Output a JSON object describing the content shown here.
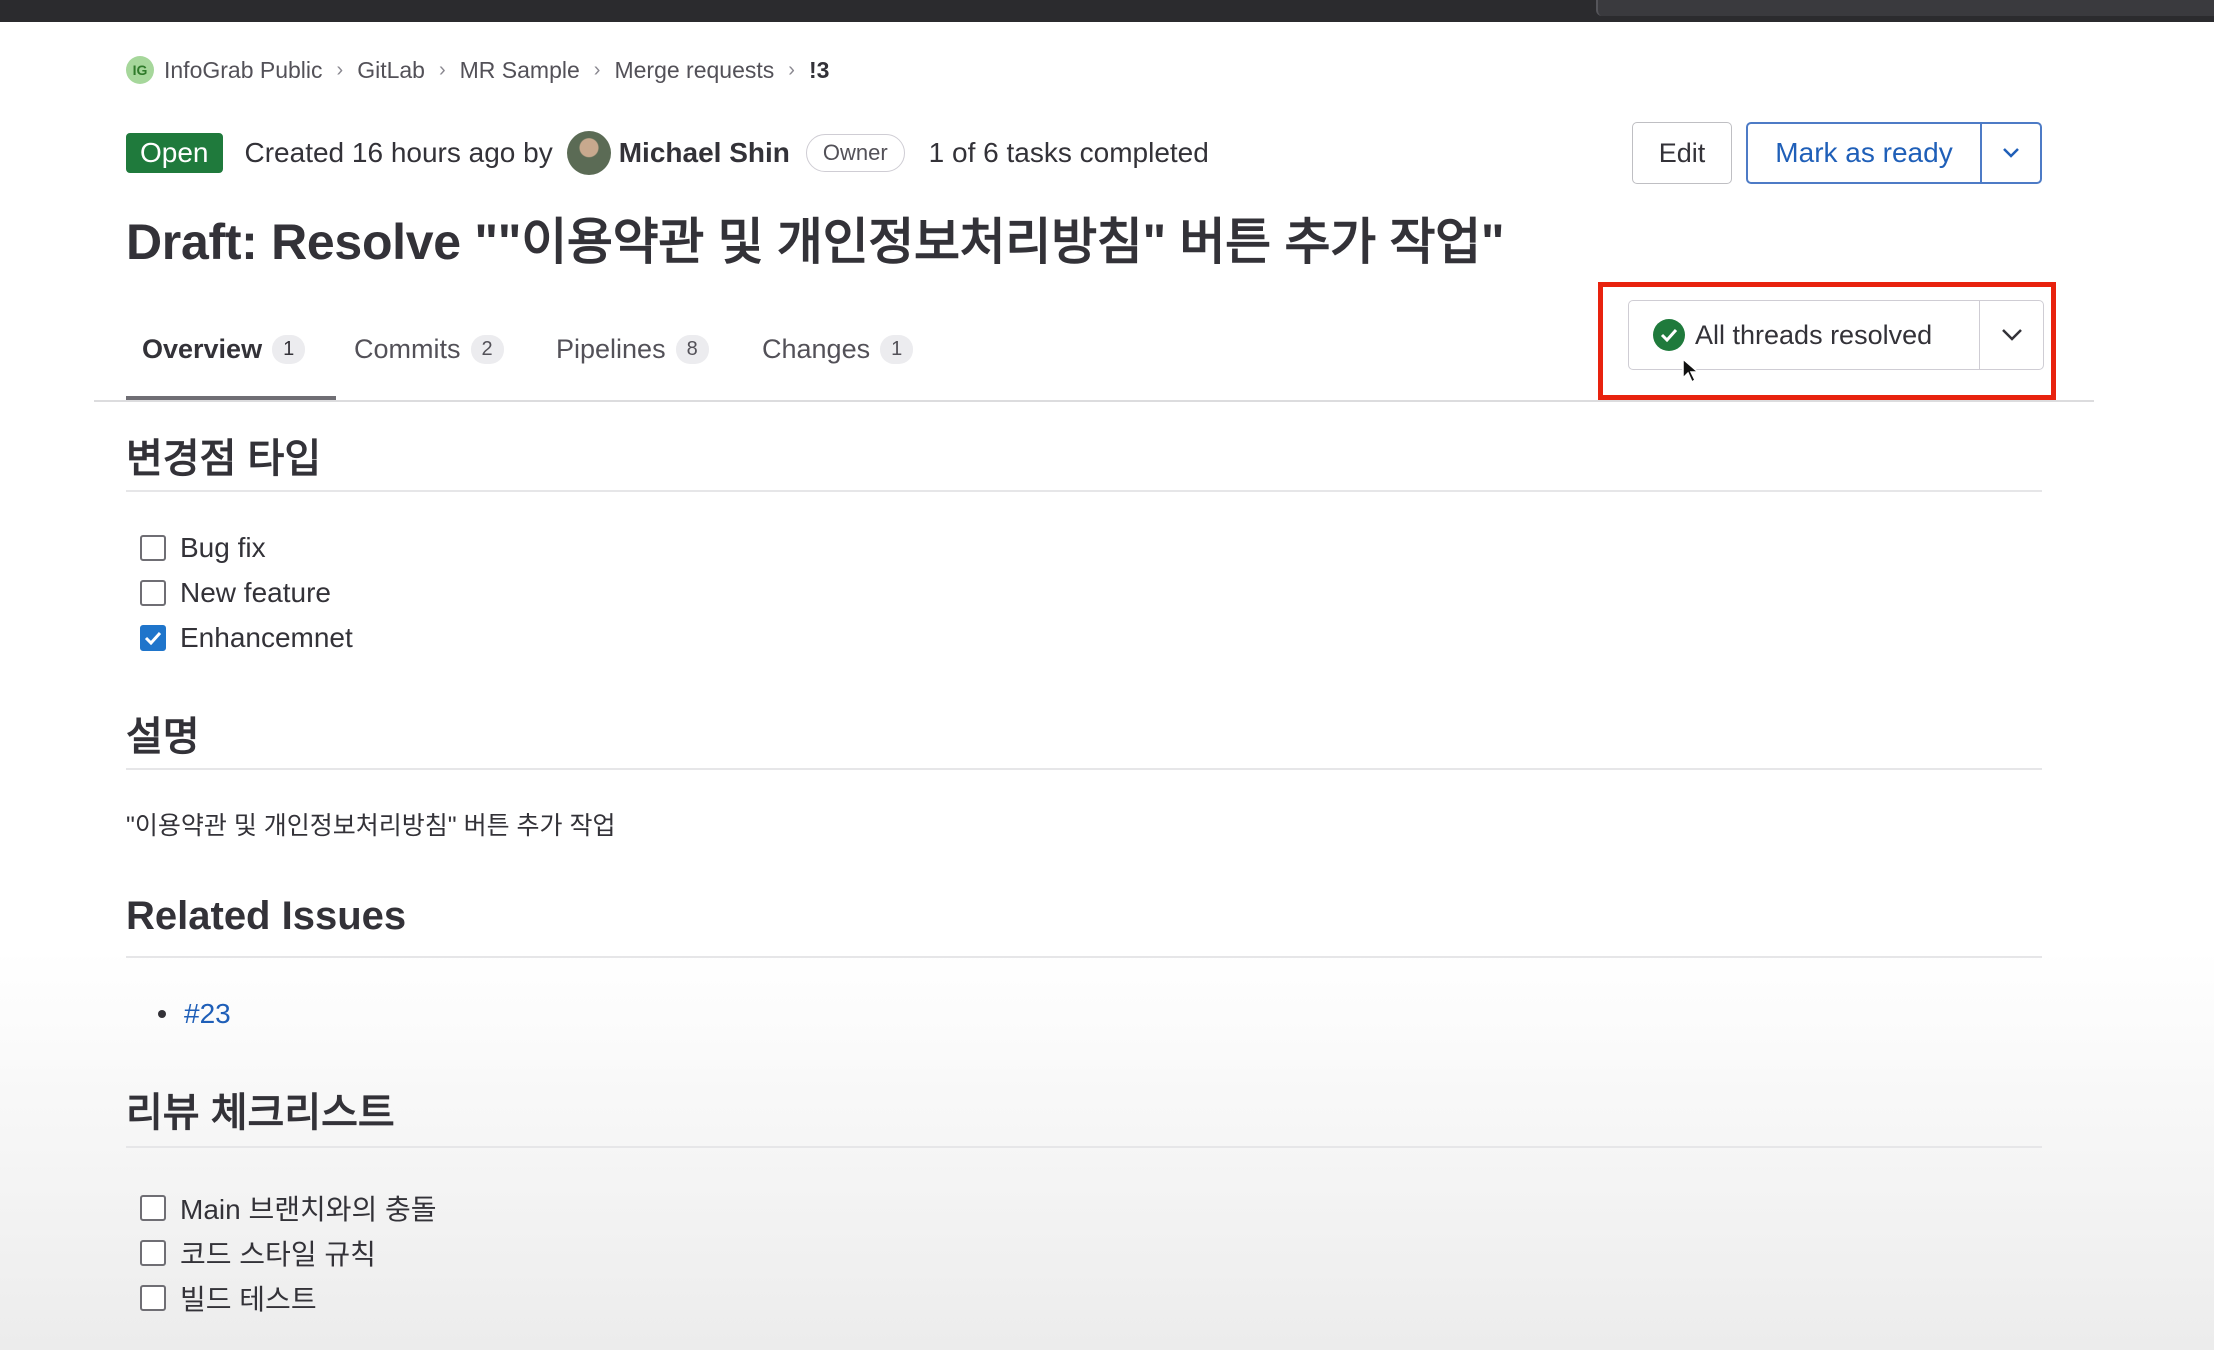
{
  "breadcrumb": {
    "logo_text": "IG",
    "items": [
      "InfoGrab Public",
      "GitLab",
      "MR Sample",
      "Merge requests",
      "!3"
    ]
  },
  "header": {
    "status": "Open",
    "created": "Created 16 hours ago by",
    "author": "Michael Shin",
    "role": "Owner",
    "tasks": "1 of 6 tasks completed",
    "edit_label": "Edit",
    "mark_ready_label": "Mark as ready"
  },
  "title": "Draft: Resolve \"\"이용약관 및 개인정보처리방침\" 버튼 추가 작업\"",
  "tabs": [
    {
      "label": "Overview",
      "count": "1"
    },
    {
      "label": "Commits",
      "count": "2"
    },
    {
      "label": "Pipelines",
      "count": "8"
    },
    {
      "label": "Changes",
      "count": "1"
    }
  ],
  "threads": {
    "label": "All threads resolved"
  },
  "sections": {
    "change_type": {
      "heading": "변경점 타입",
      "items": [
        {
          "label": "Bug fix",
          "checked": false
        },
        {
          "label": "New feature",
          "checked": false
        },
        {
          "label": "Enhancemnet",
          "checked": true
        }
      ]
    },
    "description": {
      "heading": "설명",
      "text": "\"이용약관 및 개인정보처리방침\" 버튼 추가 작업"
    },
    "related": {
      "heading": "Related Issues",
      "issues": [
        "#23"
      ]
    },
    "review": {
      "heading": "리뷰 체크리스트",
      "items": [
        {
          "label": "Main 브랜치와의 충돌",
          "checked": false
        },
        {
          "label": "코드 스타일 규칙",
          "checked": false
        },
        {
          "label": "빌드 테스트",
          "checked": false
        }
      ]
    }
  },
  "colors": {
    "open_badge": "#1f7a3c",
    "link": "#1f5fb8",
    "highlight": "#e8220e",
    "checkbox_checked": "#1f75cb"
  }
}
